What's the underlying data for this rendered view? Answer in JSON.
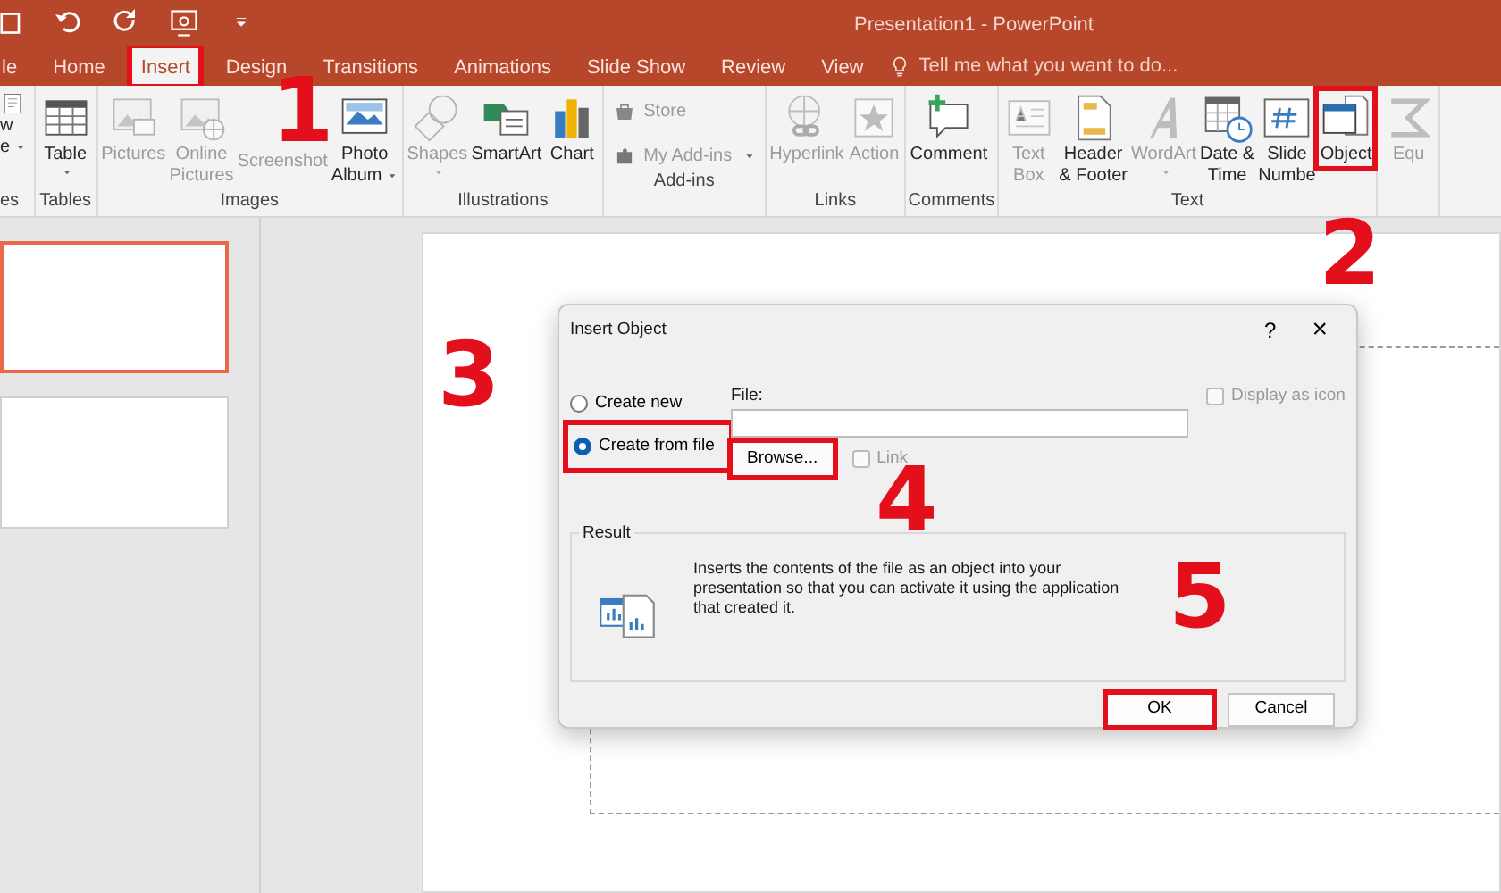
{
  "window": {
    "title": "Presentation1 - PowerPoint"
  },
  "tabs": [
    {
      "label": "le",
      "selected": false,
      "highlighted": false
    },
    {
      "label": "Home",
      "selected": false,
      "highlighted": false
    },
    {
      "label": "Insert",
      "selected": true,
      "highlighted": true
    },
    {
      "label": "Design",
      "selected": false,
      "highlighted": false
    },
    {
      "label": "Transitions",
      "selected": false,
      "highlighted": false
    },
    {
      "label": "Animations",
      "selected": false,
      "highlighted": false
    },
    {
      "label": "Slide Show",
      "selected": false,
      "highlighted": false
    },
    {
      "label": "Review",
      "selected": false,
      "highlighted": false
    },
    {
      "label": "View",
      "selected": false,
      "highlighted": false
    }
  ],
  "tell_me": {
    "placeholder": "Tell me what you want to do..."
  },
  "ribbon_groups": [
    {
      "label": "es",
      "commands": [
        {
          "kind": "page",
          "lines": [
            "w",
            "e"
          ],
          "dropdown": true,
          "disabled": false,
          "highlighted": false
        }
      ]
    },
    {
      "label": "Tables",
      "commands": [
        {
          "kind": "table",
          "lines": [
            "Table"
          ],
          "dropdown": true,
          "disabled": false,
          "highlighted": false
        }
      ]
    },
    {
      "label": "Images",
      "commands": [
        {
          "kind": "pictures",
          "lines": [
            "Pictures"
          ],
          "dropdown": false,
          "disabled": true,
          "highlighted": false
        },
        {
          "kind": "online-pictures",
          "lines": [
            "Online",
            "Pictures"
          ],
          "dropdown": false,
          "disabled": true,
          "highlighted": false
        },
        {
          "kind": "screenshot",
          "lines": [
            "Screenshot"
          ],
          "dropdown": false,
          "disabled": true,
          "highlighted": false
        },
        {
          "kind": "photo-album",
          "lines": [
            "Photo",
            "Album"
          ],
          "dropdown": true,
          "disabled": false,
          "highlighted": false
        }
      ]
    },
    {
      "label": "Illustrations",
      "commands": [
        {
          "kind": "shapes",
          "lines": [
            "Shapes"
          ],
          "dropdown": true,
          "disabled": true,
          "highlighted": false
        },
        {
          "kind": "smartart",
          "lines": [
            "SmartArt"
          ],
          "dropdown": false,
          "disabled": false,
          "highlighted": false
        },
        {
          "kind": "chart",
          "lines": [
            "Chart"
          ],
          "dropdown": false,
          "disabled": false,
          "highlighted": false
        }
      ]
    },
    {
      "label": "Add-ins",
      "commands": [
        {
          "kind": "store",
          "lines": [
            "Store"
          ],
          "dropdown": false,
          "disabled": true,
          "highlighted": false
        },
        {
          "kind": "add-ins",
          "lines": [
            "My Add-ins"
          ],
          "dropdown": true,
          "disabled": true,
          "highlighted": false
        }
      ]
    },
    {
      "label": "Links",
      "commands": [
        {
          "kind": "hyperlink",
          "lines": [
            "Hyperlink"
          ],
          "dropdown": false,
          "disabled": true,
          "highlighted": false
        },
        {
          "kind": "action",
          "lines": [
            "Action"
          ],
          "dropdown": false,
          "disabled": true,
          "highlighted": false
        }
      ]
    },
    {
      "label": "Comments",
      "commands": [
        {
          "kind": "comment",
          "lines": [
            "Comment"
          ],
          "dropdown": false,
          "disabled": false,
          "highlighted": false
        }
      ]
    },
    {
      "label": "Text",
      "commands": [
        {
          "kind": "text-box",
          "lines": [
            "Text",
            "Box"
          ],
          "dropdown": false,
          "disabled": true,
          "highlighted": false
        },
        {
          "kind": "header-footer",
          "lines": [
            "Header",
            "& Footer"
          ],
          "dropdown": false,
          "disabled": false,
          "highlighted": false
        },
        {
          "kind": "wordart",
          "lines": [
            "WordArt"
          ],
          "dropdown": true,
          "disabled": true,
          "highlighted": false
        },
        {
          "kind": "date-time",
          "lines": [
            "Date &",
            "Time"
          ],
          "dropdown": false,
          "disabled": false,
          "highlighted": false
        },
        {
          "kind": "slide-number",
          "lines": [
            "Slide",
            "Numbe"
          ],
          "dropdown": false,
          "disabled": false,
          "highlighted": false
        },
        {
          "kind": "object",
          "lines": [
            "Object"
          ],
          "dropdown": false,
          "disabled": false,
          "highlighted": true
        }
      ]
    },
    {
      "commands": [
        {
          "kind": "equation",
          "lines": [
            "Equ"
          ],
          "dropdown": false,
          "disabled": true,
          "highlighted": false
        }
      ]
    }
  ],
  "thumbnails": [
    {
      "selected": true
    },
    {
      "selected": false
    }
  ],
  "dialog": {
    "title": "Insert Object",
    "help": "?",
    "close": "×",
    "options": [
      {
        "label": "Create new",
        "selected": false,
        "highlighted": false
      },
      {
        "label": "Create from file",
        "selected": true,
        "highlighted": true
      }
    ],
    "file_label": "File:",
    "browse": {
      "label": "Browse...",
      "highlighted": true
    },
    "link": {
      "label": "Link",
      "checked": false,
      "disabled": true
    },
    "display_as_icon": {
      "label": "Display as icon",
      "checked": false,
      "disabled": true
    },
    "result": {
      "legend": "Result",
      "text": "Inserts the contents of the file as an object into your presentation so that you can activate it using the application that created it."
    },
    "buttons": [
      {
        "label": "OK",
        "highlighted": true
      },
      {
        "label": "Cancel",
        "highlighted": false
      }
    ]
  },
  "steps": [
    "1",
    "2",
    "3",
    "4",
    "5"
  ]
}
